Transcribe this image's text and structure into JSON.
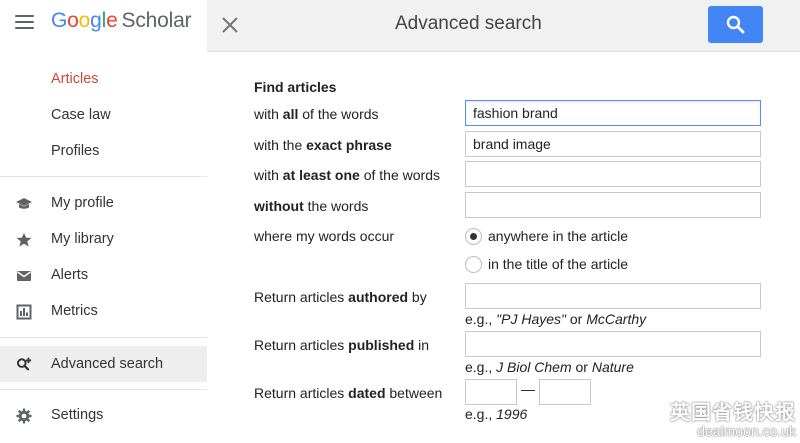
{
  "brand": {
    "google": [
      "G",
      "o",
      "o",
      "g",
      "l",
      "e"
    ],
    "product": "Scholar"
  },
  "header": {
    "title": "Advanced search"
  },
  "sidebar": {
    "top_items": [
      {
        "label": "Articles"
      },
      {
        "label": "Case law"
      },
      {
        "label": "Profiles"
      }
    ],
    "items": [
      {
        "label": "My profile",
        "icon": "graduation-cap-icon"
      },
      {
        "label": "My library",
        "icon": "star-icon"
      },
      {
        "label": "Alerts",
        "icon": "envelope-icon"
      },
      {
        "label": "Metrics",
        "icon": "metrics-icon"
      },
      {
        "label": "Advanced search",
        "icon": "advanced-search-icon"
      },
      {
        "label": "Settings",
        "icon": "gear-icon"
      }
    ]
  },
  "form": {
    "section_title": "Find articles",
    "all_words": {
      "pre": "with ",
      "bold": "all",
      "post": " of the words",
      "value": "fashion brand"
    },
    "exact_phrase": {
      "pre": "with the ",
      "bold": "exact phrase",
      "post": "",
      "value": "brand image"
    },
    "at_least_one": {
      "pre": "with ",
      "bold": "at least one",
      "post": " of the words",
      "value": ""
    },
    "without": {
      "pre": "",
      "bold": "without",
      "post": " the words",
      "value": ""
    },
    "occur": {
      "label": "where my words occur",
      "options": [
        "anywhere in the article",
        "in the title of the article"
      ],
      "selected": "anywhere in the article"
    },
    "authored": {
      "pre": "Return articles ",
      "bold": "authored",
      "post": " by",
      "value": "",
      "hint_pre": "e.g., ",
      "hint_a": "\"PJ Hayes\"",
      "hint_mid": " or ",
      "hint_b": "McCarthy"
    },
    "published": {
      "pre": "Return articles ",
      "bold": "published",
      "post": " in",
      "value": "",
      "hint_pre": "e.g., ",
      "hint_a": "J Biol Chem",
      "hint_mid": " or ",
      "hint_b": "Nature"
    },
    "dated": {
      "pre": "Return articles ",
      "bold": "dated",
      "post": " between",
      "from": "",
      "to": "",
      "separator": "—",
      "hint_pre": "e.g., ",
      "hint_a": "1996"
    }
  },
  "watermark": {
    "line1": "英国省钱快报",
    "line2": "dealmoon.co.uk"
  },
  "colors": {
    "accent": "#4285f4",
    "active_nav": "#d14836",
    "topbar": "#f1f1f1"
  }
}
